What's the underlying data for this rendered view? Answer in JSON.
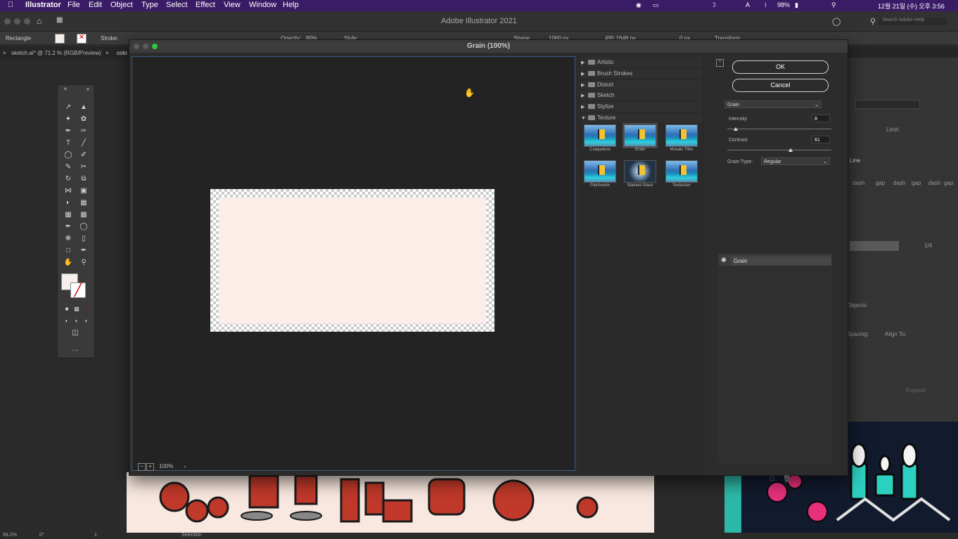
{
  "menubar": {
    "app": "Illustrator",
    "items": [
      "File",
      "Edit",
      "Object",
      "Type",
      "Select",
      "Effect",
      "View",
      "Window",
      "Help"
    ],
    "status": {
      "battery": "98%",
      "datetime": "12월 21일 (수) 오후 3:56"
    }
  },
  "app_title": "Adobe Illustrator 2021",
  "control_bar": {
    "object_type": "Rectangle",
    "stroke_label": "Stroke:",
    "opacity_label": "Opacity:",
    "opacity_value": "80%",
    "style_label": "Style:",
    "shape_label": "Shape",
    "width_value": "1060 px",
    "x_value": "495.1648 px",
    "corner_value": "0 px",
    "transform_label": "Transform",
    "search_placeholder": "Search Adobe Help"
  },
  "doc_tabs": [
    "sketch.ai* @ 71.2 % (RGB/Preview)",
    "colo"
  ],
  "dialog": {
    "title": "Grain (100%)",
    "preview_zoom": "100%",
    "categories": [
      {
        "name": "Artistic",
        "expanded": false
      },
      {
        "name": "Brush Strokes",
        "expanded": false
      },
      {
        "name": "Distort",
        "expanded": false
      },
      {
        "name": "Sketch",
        "expanded": false
      },
      {
        "name": "Stylize",
        "expanded": false
      },
      {
        "name": "Texture",
        "expanded": true
      }
    ],
    "texture_filters": [
      "Craquelure",
      "Grain",
      "Mosaic Tiles",
      "Patchwork",
      "Stained Glass",
      "Texturizer"
    ],
    "selected_filter": "Grain",
    "ok_label": "OK",
    "cancel_label": "Cancel",
    "filter_dropdown": "Grain",
    "intensity_label": "Intensity",
    "intensity_value": "8",
    "intensity_max": 100,
    "contrast_label": "Contrast",
    "contrast_value": "61",
    "contrast_max": 100,
    "grain_type_label": "Grain Type:",
    "grain_type_value": "Regular",
    "effect_layer": "Grain"
  },
  "right_panel": {
    "line_label": "Line",
    "dash_labels": [
      "dash",
      "gap",
      "dash",
      "gap",
      "dash",
      "gap"
    ],
    "objects_label": "Objects:",
    "spacing_label": "Spacing:",
    "align_to_label": "Align To:",
    "expand_label": "Expand",
    "limit_label": "Limit:",
    "page_indicator": "1/4"
  },
  "status_bar": {
    "zoom": "56.2%",
    "angle": "0°",
    "artboard": "1",
    "tool": "Selection"
  },
  "colors": {
    "menubar": "#3a1c66",
    "canvas_fill": "#fbeee9",
    "focus_border": "#3b5b8a"
  }
}
